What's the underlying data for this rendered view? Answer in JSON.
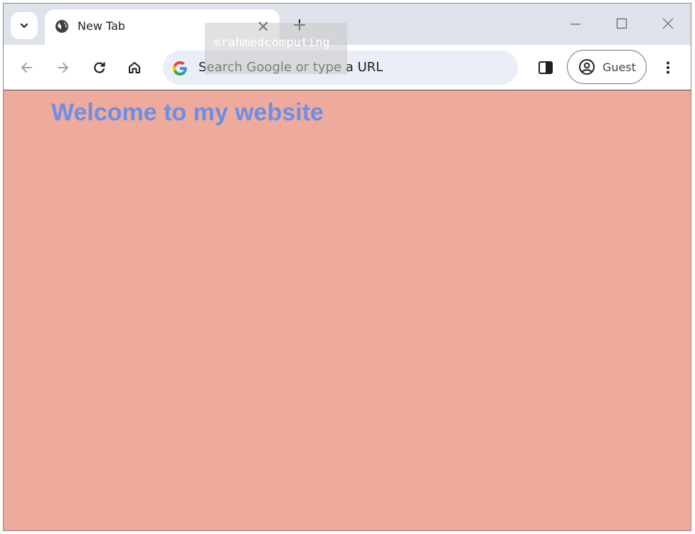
{
  "browser": {
    "tab": {
      "title": "New Tab",
      "favicon": "globe-icon"
    },
    "omnibox": {
      "placeholder": "Search Google or type a URL"
    },
    "profile": {
      "label": "Guest"
    }
  },
  "page": {
    "heading": "Welcome to my website",
    "background_color": "#eeaa9d",
    "heading_color": "#6b8fe6"
  },
  "watermark": {
    "text": "mrahmedcomputing"
  }
}
